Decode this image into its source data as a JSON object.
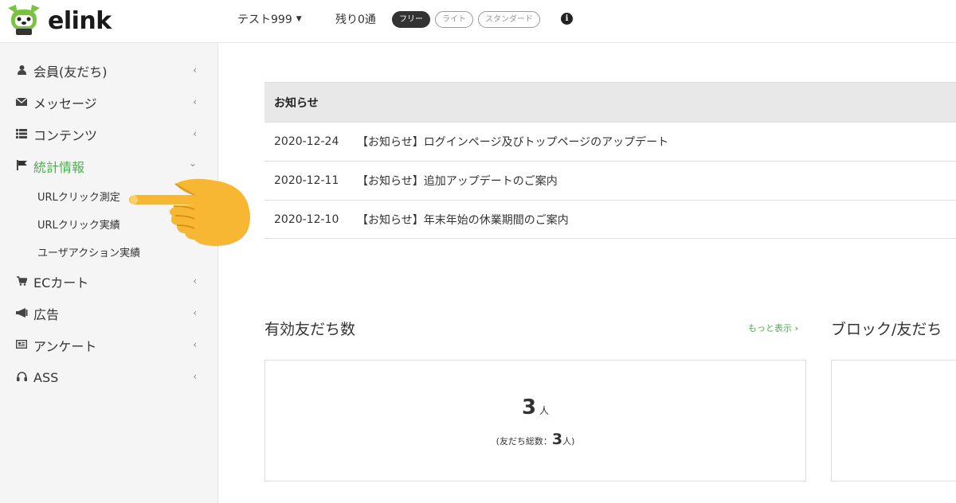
{
  "header": {
    "logo_text": "elink",
    "account_name": "テスト999",
    "remaining": "残り0通",
    "plans": [
      "フリー",
      "ライト",
      "スタンダード"
    ],
    "info_icon": "info-circle-icon"
  },
  "sidebar": {
    "items": [
      {
        "icon": "user-icon",
        "label": "会員(友だち)"
      },
      {
        "icon": "envelope-icon",
        "label": "メッセージ"
      },
      {
        "icon": "list-icon",
        "label": "コンテンツ"
      },
      {
        "icon": "flag-icon",
        "label": "統計情報"
      },
      {
        "icon": "cart-icon",
        "label": "ECカート"
      },
      {
        "icon": "bullhorn-icon",
        "label": "広告"
      },
      {
        "icon": "newspaper-icon",
        "label": "アンケート"
      },
      {
        "icon": "headphones-icon",
        "label": "ASS"
      }
    ],
    "sub_items": [
      "URLクリック測定",
      "URLクリック実績",
      "ユーザアクション実績"
    ],
    "active_color": "#4caf50"
  },
  "news": {
    "title": "お知らせ",
    "rows": [
      {
        "date": "2020-12-24",
        "text": "【お知らせ】ログインページ及びトップページのアップデート"
      },
      {
        "date": "2020-12-11",
        "text": "【お知らせ】追加アップデートのご案内"
      },
      {
        "date": "2020-12-10",
        "text": "【お知らせ】年末年始の休業期間のご案内"
      }
    ]
  },
  "friends": {
    "title": "有効友だち数",
    "more": "もっと表示",
    "count": "3",
    "unit": "人",
    "total_prefix": "(友だち総数：",
    "total": "3",
    "total_suffix": "人)"
  },
  "blocks": {
    "title": "ブロック/友だち"
  }
}
